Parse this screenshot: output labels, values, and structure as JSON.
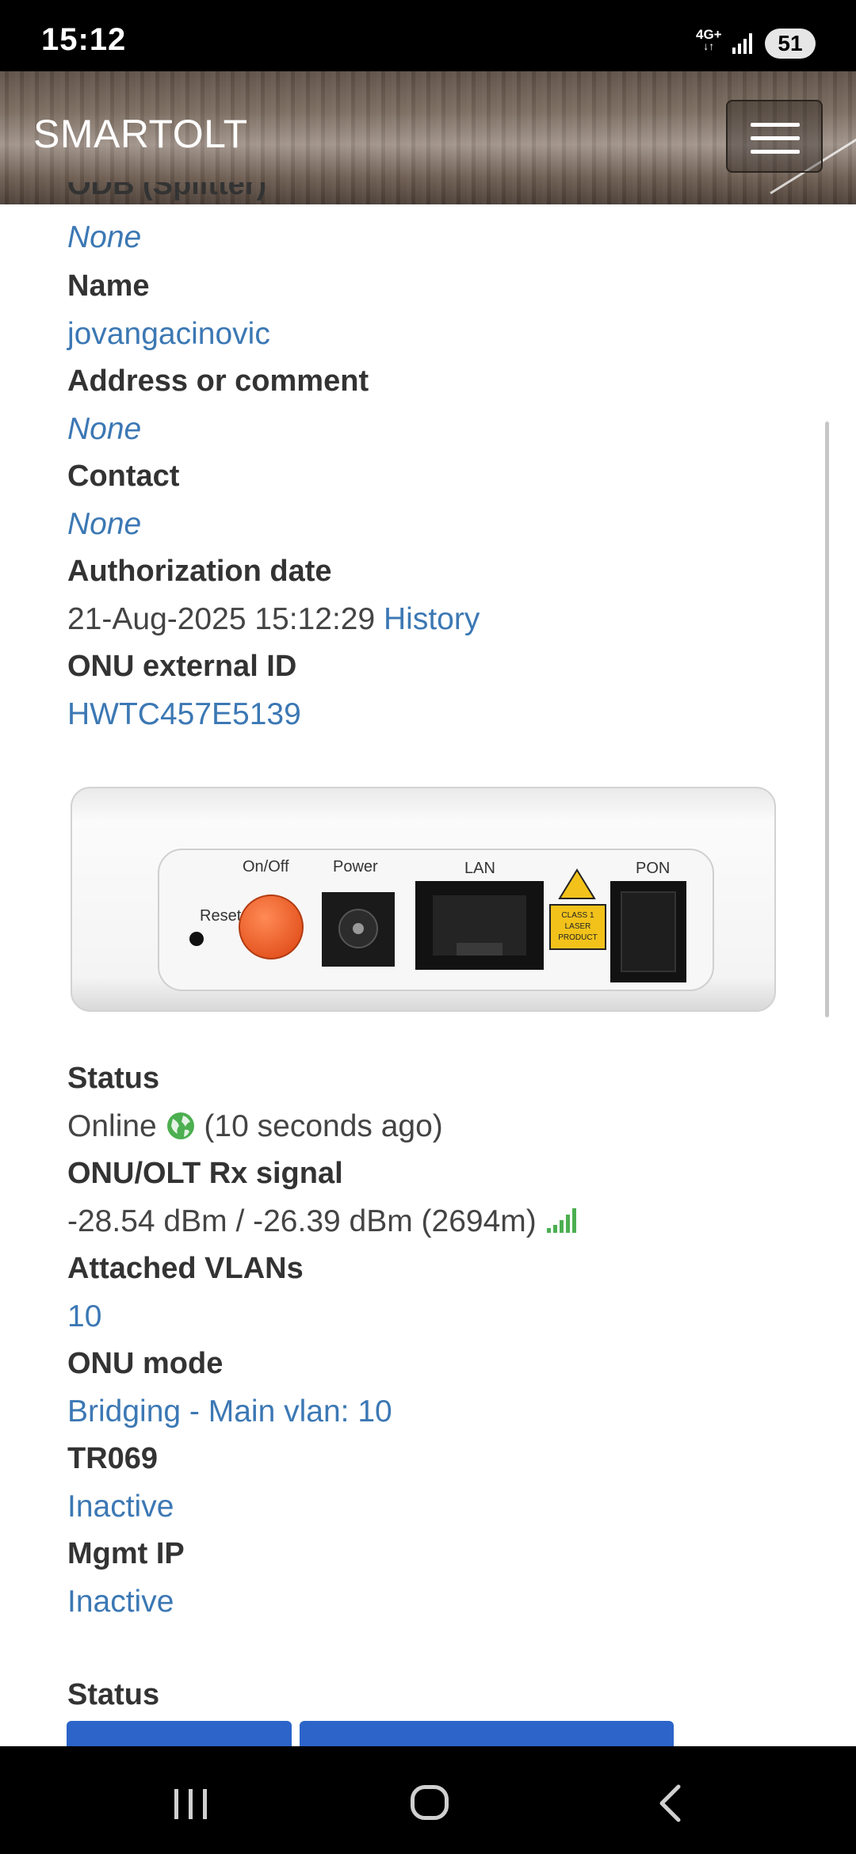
{
  "status_bar": {
    "time": "15:12",
    "network": "4G+",
    "battery": "51"
  },
  "header": {
    "brand": "SMARTOLT"
  },
  "details": {
    "odb_partial_label": "ODB (Splitter)",
    "odb_value": "None",
    "name_label": "Name",
    "name_value": "jovangacinovic",
    "address_label": "Address or comment",
    "address_value": "None",
    "contact_label": "Contact",
    "contact_value": "None",
    "auth_date_label": "Authorization date",
    "auth_date_value": "21-Aug-2025 15:12:29",
    "history_link": "History",
    "external_id_label": "ONU external ID",
    "external_id_value": "HWTC457E5139"
  },
  "device_image": {
    "reset": "Reset",
    "onoff": "On/Off",
    "power": "Power",
    "lan": "LAN",
    "pon": "PON",
    "laser_line1": "CLASS 1",
    "laser_line2": "LASER",
    "laser_line3": "PRODUCT"
  },
  "status_section": {
    "status_label": "Status",
    "status_value": "Online",
    "status_ago": "(10 seconds ago)",
    "signal_label": "ONU/OLT Rx signal",
    "signal_value": "-28.54 dBm / -26.39 dBm (2694m)",
    "vlans_label": "Attached VLANs",
    "vlans_value": "10",
    "mode_label": "ONU mode",
    "mode_value": "Bridging - Main vlan: 10",
    "tr069_label": "TR069",
    "tr069_value": "Inactive",
    "mgmt_label": "Mgmt IP",
    "mgmt_value": "Inactive",
    "status2_label": "Status"
  },
  "colors": {
    "link": "#3c78b4",
    "online_icon": "#4caf50",
    "signal_bars": "#4caf50",
    "action_button": "#2c64c9"
  },
  "icons": {
    "online": "globe-icon",
    "signal": "signal-strength-icon",
    "menu": "hamburger-icon"
  }
}
